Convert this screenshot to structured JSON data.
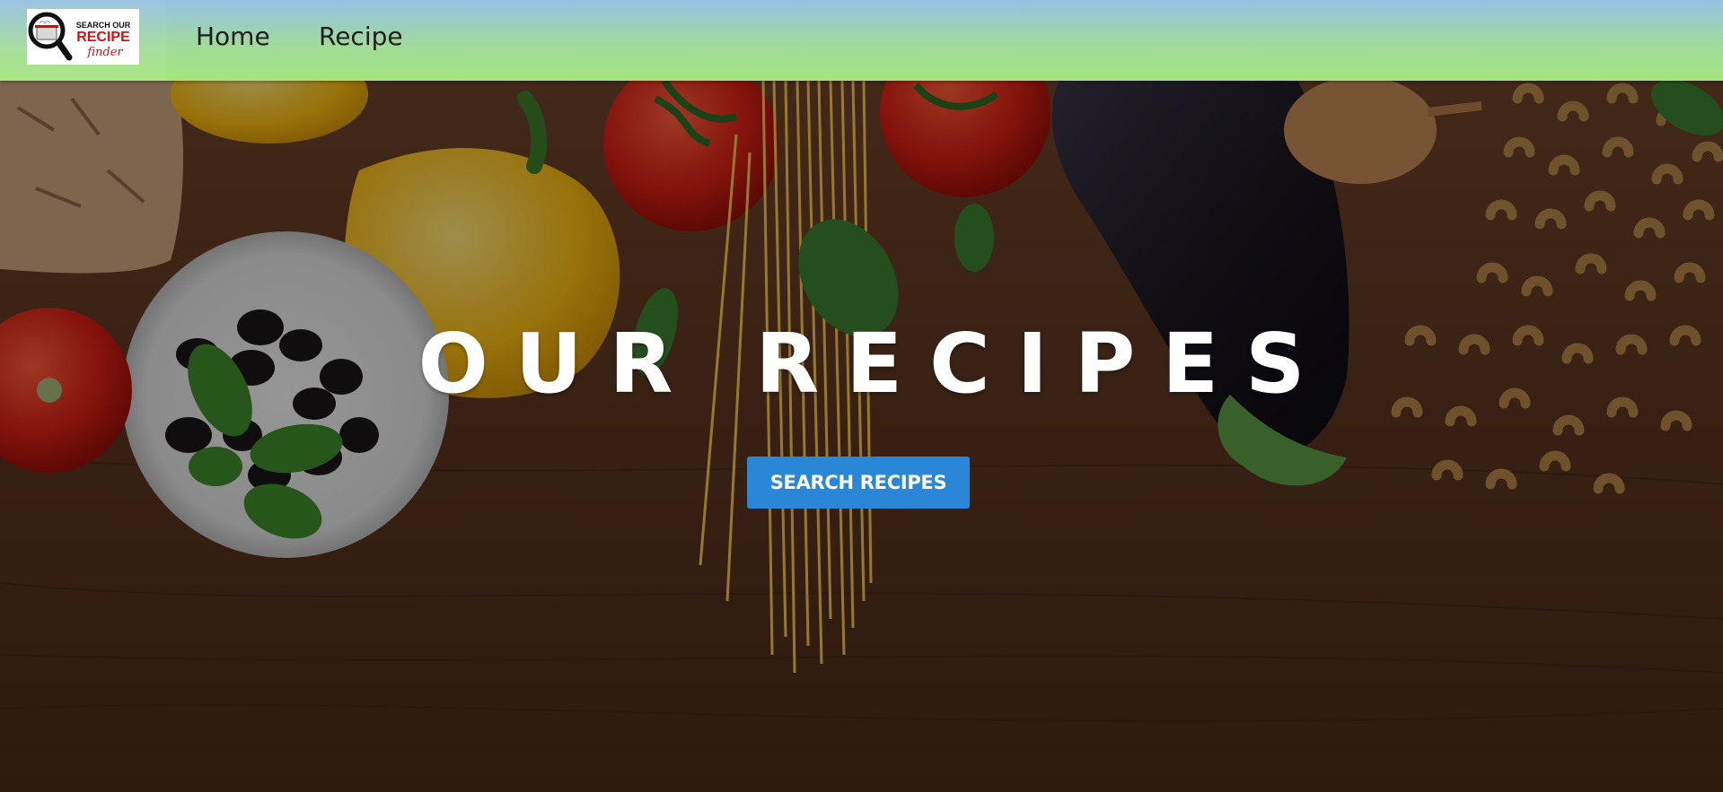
{
  "brand": {
    "logo_line1": "SEARCH OUR",
    "logo_line2": "RECIPE",
    "logo_line3": "finder"
  },
  "nav": {
    "items": [
      {
        "label": "Home"
      },
      {
        "label": "Recipe"
      }
    ]
  },
  "hero": {
    "title": "OUR RECIPES",
    "cta_label": "SEARCH RECIPES"
  },
  "colors": {
    "nav_gradient_top": "#95c1e3",
    "nav_gradient_bottom": "#a4e57c",
    "cta": "#2a86d6",
    "wood": "#5a3520"
  },
  "icons": {
    "logo": "magnifier-pot-icon"
  }
}
